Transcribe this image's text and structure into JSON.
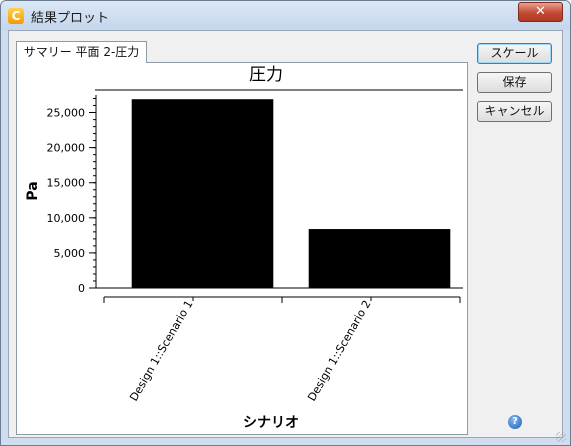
{
  "window": {
    "title": "結果プロット",
    "app_icon": "app-c-icon",
    "close_glyph": "✕"
  },
  "tab": {
    "label": "サマリー 平面 2-圧力"
  },
  "buttons": {
    "scale": "スケール",
    "save": "保存",
    "cancel": "キャンセル"
  },
  "help": {
    "icon": "help-icon",
    "glyph": "?"
  },
  "chart_data": {
    "type": "bar",
    "title": "圧力",
    "ylabel": "Pa",
    "xlabel": "シナリオ",
    "categories": [
      "Design 1::Scenario 1",
      "Design 1::Scenario 2"
    ],
    "values": [
      26900,
      8400
    ],
    "ylim": [
      0,
      27500
    ],
    "yticks": [
      0,
      5000,
      10000,
      15000,
      20000,
      25000
    ],
    "ytick_labels": [
      "0",
      "5,000",
      "10,000",
      "15,000",
      "20,000",
      "25,000"
    ],
    "bar_color": "#000000",
    "grid": false,
    "legend": "none"
  }
}
